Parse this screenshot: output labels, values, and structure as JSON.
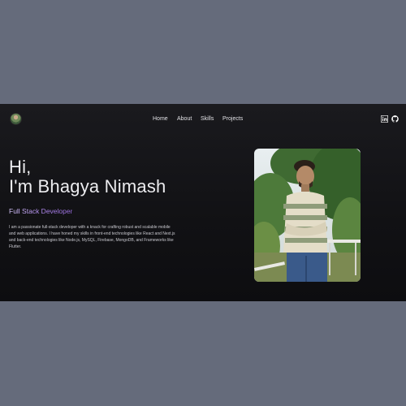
{
  "nav": {
    "items": [
      {
        "label": "Home"
      },
      {
        "label": "About"
      },
      {
        "label": "Skills"
      },
      {
        "label": "Projects"
      }
    ]
  },
  "social": {
    "icons": [
      "linkedin-icon",
      "github-icon"
    ]
  },
  "hero": {
    "greeting_line1": "Hi,",
    "greeting_line2": "I'm Bhagya Nimash",
    "role": "Full Stack Developer",
    "bio": "I am a passionate full-stack developer with a knack for crafting robust and scalable mobile and web applications. I have honed my skills in front-end technologies like React and Next.js and back-end technologies like Node.js, MySQL, Firebase, MongoDB, and Frameworks like Flutter."
  },
  "colors": {
    "page_background": "#656b7b",
    "screen_background": "#121215",
    "accent_purple": "#b48cf2",
    "text_light": "#ececef"
  }
}
